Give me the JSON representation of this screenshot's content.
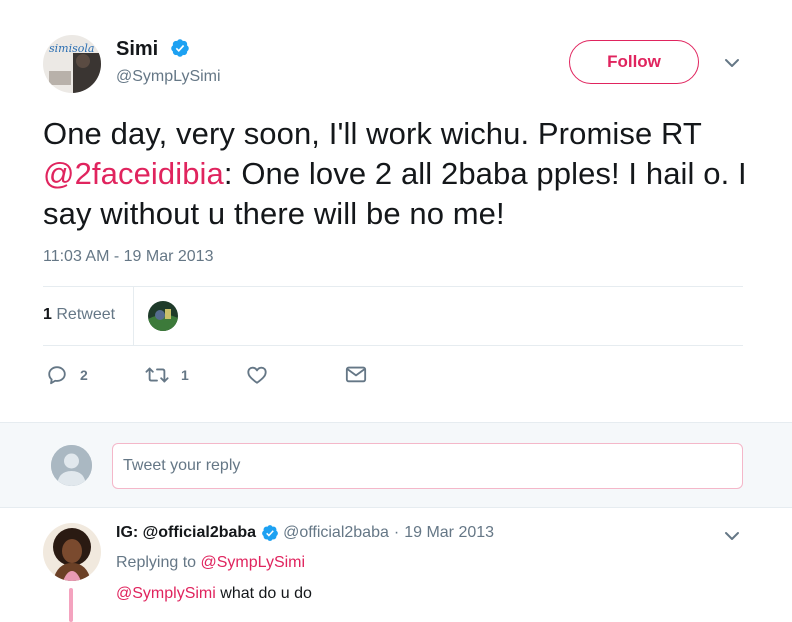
{
  "tweet": {
    "author": {
      "name": "Simi",
      "handle": "@SympLySimi",
      "verified": true,
      "avatar_logo_text": "simisola"
    },
    "follow_label": "Follow",
    "text_before": "One day, very soon, I'll work wichu. Promise RT ",
    "mention": "@2faceidibia",
    "text_after": ": One love 2 all 2baba pples! I hail o. I say without u there will be no me!",
    "timestamp": "11:03 AM - 19 Mar 2013",
    "stats": {
      "retweet_count": "1",
      "retweet_label": "Retweet"
    },
    "actions": {
      "reply_count": "2",
      "retweet_count": "1"
    }
  },
  "reply_box": {
    "placeholder": "Tweet your reply"
  },
  "reply": {
    "name": "IG: @official2baba",
    "verified": true,
    "handle": "@official2baba",
    "separator": "·",
    "date": "19 Mar 2013",
    "replying_prefix": "Replying to",
    "replying_to": "@SympLySimi",
    "mention": "@SymplySimi",
    "text": "what do u do"
  },
  "colors": {
    "accent": "#e0245e",
    "verified_blue": "#1da1f2",
    "muted": "#657786",
    "divider": "#e6ecf0"
  },
  "icons": [
    "verified-icon",
    "chevron-down-icon",
    "reply-icon",
    "retweet-icon",
    "like-icon",
    "direct-message-icon",
    "default-avatar-icon"
  ]
}
